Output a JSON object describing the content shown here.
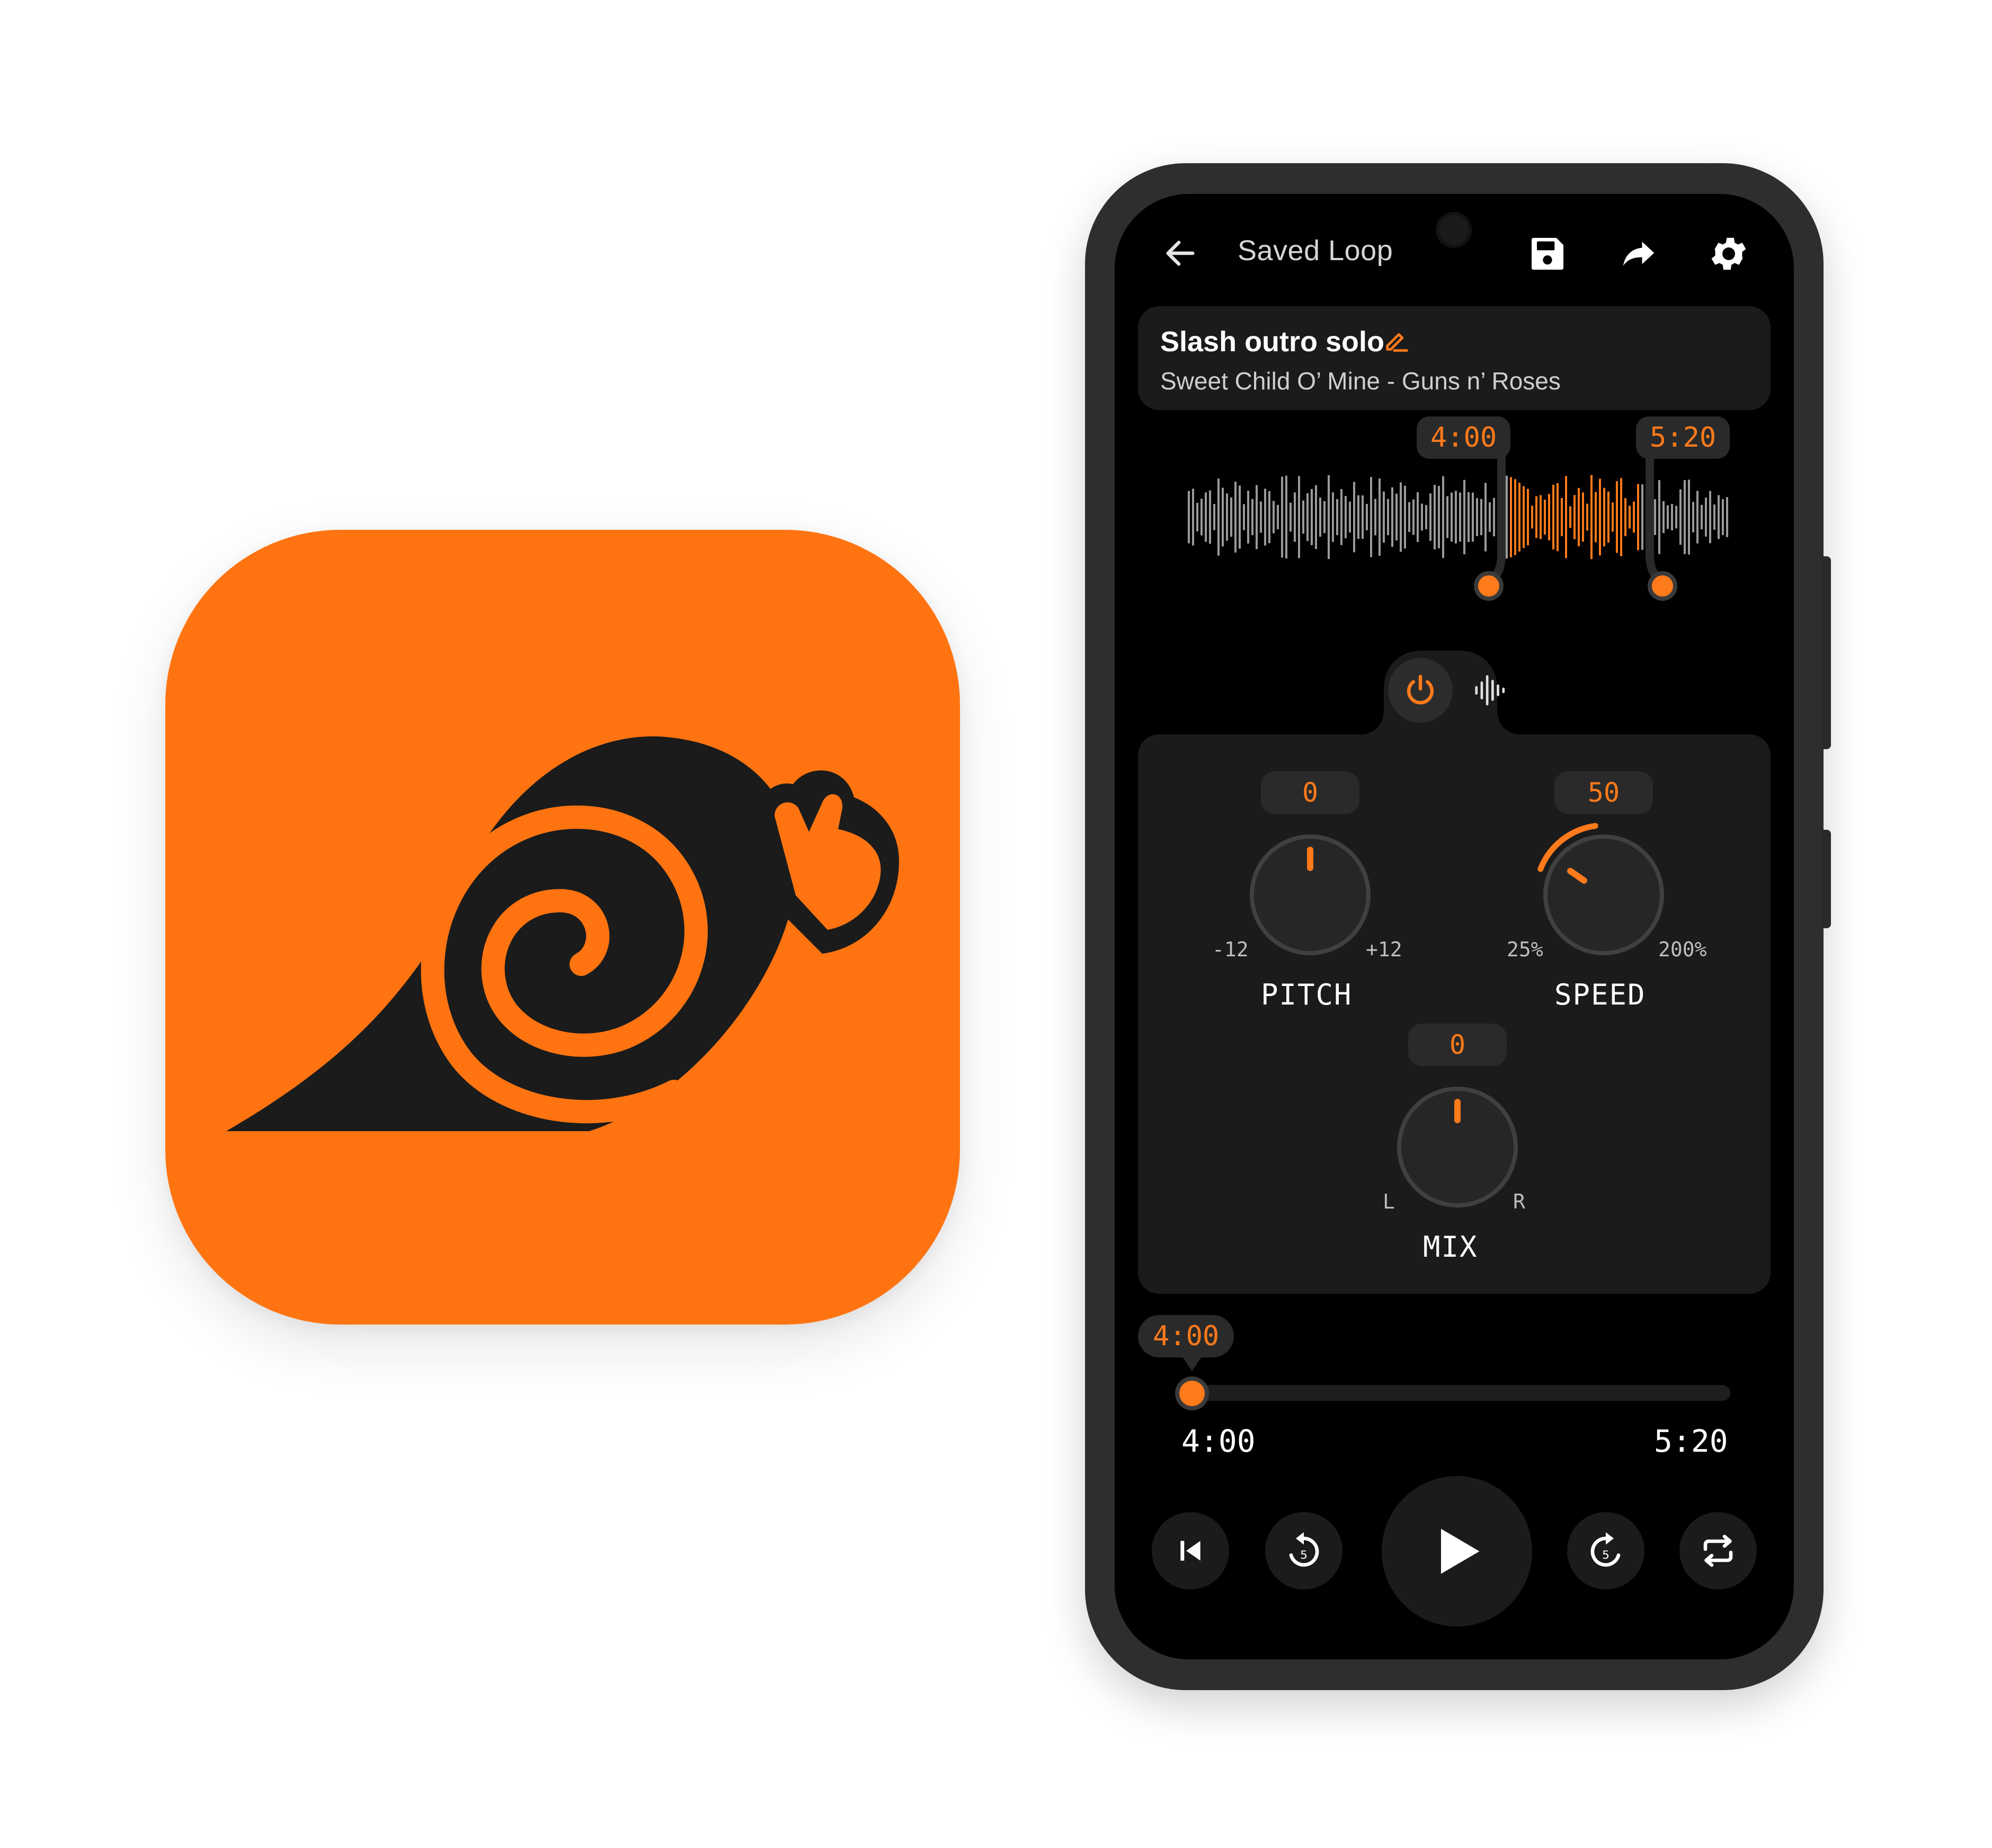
{
  "theme": {
    "accent": "#ff7a1a",
    "icon_bg": "#ff7411",
    "screen_bg": "#000000",
    "card_bg": "#1b1b1b"
  },
  "app_icon": {
    "icon": "snail-logo-icon"
  },
  "topbar": {
    "title": "Saved Loop",
    "icons": [
      "back-arrow-icon",
      "save-icon",
      "share-icon",
      "gear-icon"
    ]
  },
  "loop": {
    "name": "Slash outro solo",
    "subtitle": "Sweet Child O’ Mine - Guns n’ Roses",
    "start": "4:00",
    "end": "5:20"
  },
  "effects": {
    "tabs": [
      "power-icon",
      "waveform-icon"
    ],
    "pitch": {
      "label": "PITCH",
      "value": "0",
      "min": "-12",
      "max": "+12"
    },
    "speed": {
      "label": "SPEED",
      "value": "50",
      "min": "25%",
      "max": "200%"
    },
    "mix": {
      "label": "MIX",
      "value": "0",
      "min": "L",
      "max": "R"
    }
  },
  "player": {
    "current": "4:00",
    "start": "4:00",
    "end": "5:20",
    "progress": 0,
    "controls": [
      "skip-back-icon",
      "rewind-5-icon",
      "play-icon",
      "forward-5-icon",
      "repeat-icon"
    ],
    "rewind_label": "5",
    "forward_label": "5"
  }
}
